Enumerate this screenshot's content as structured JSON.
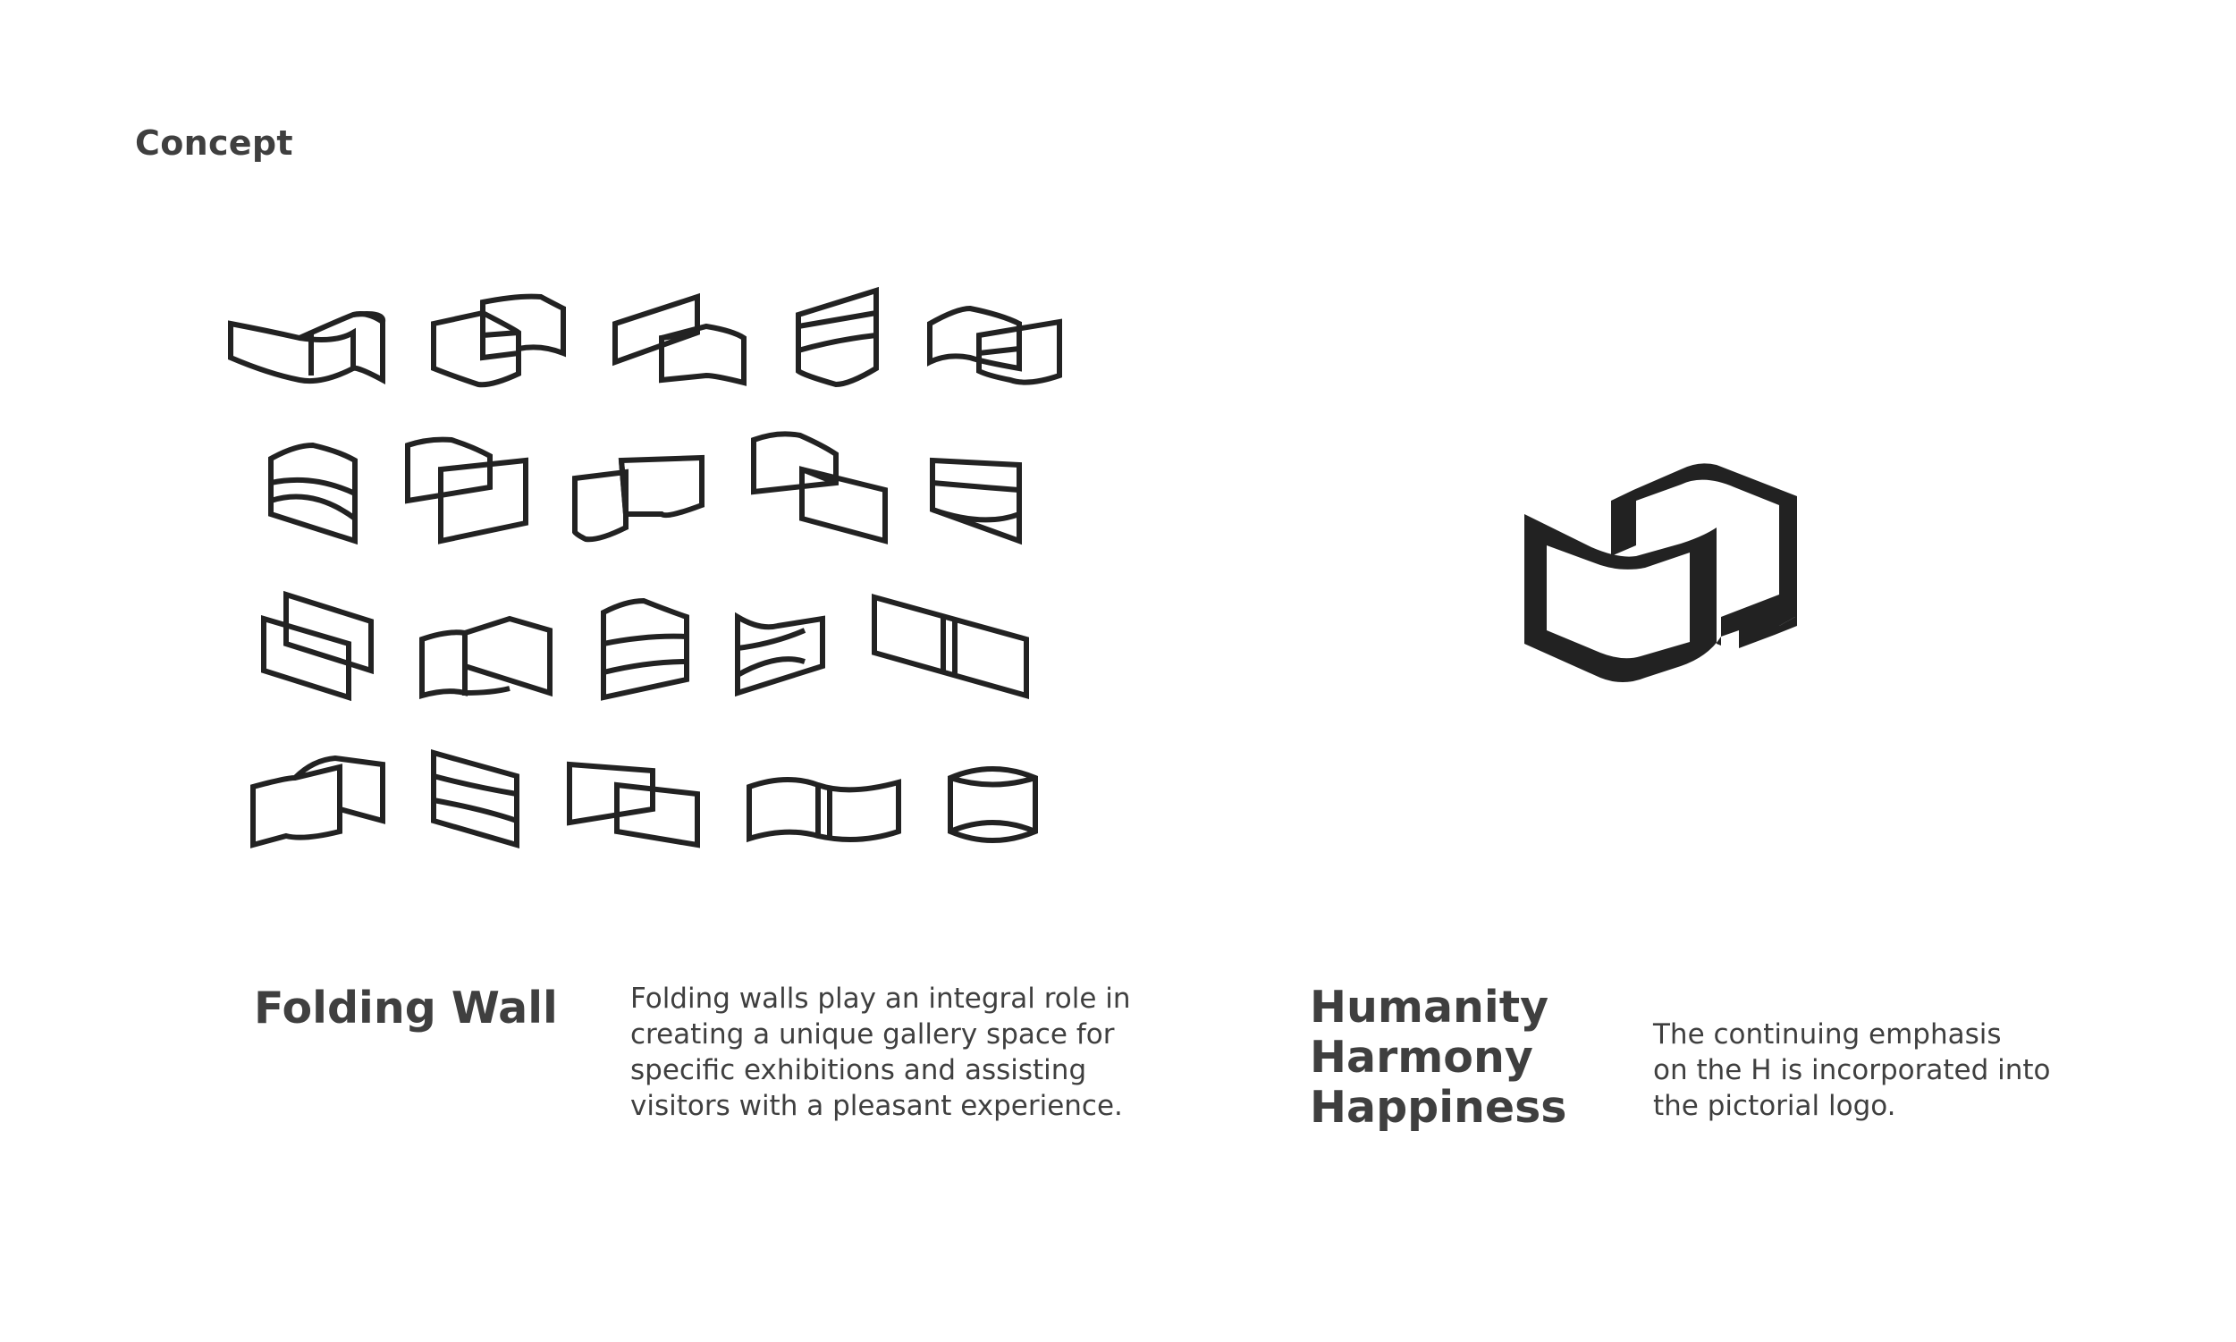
{
  "page": {
    "title": "Concept"
  },
  "folding_wall": {
    "heading": "Folding Wall",
    "description_lines": [
      "Folding walls play an integral role in",
      "creating a unique gallery space for",
      "specific exhibitions and assisting",
      "visitors with a pleasant experience."
    ],
    "sketch_icon_name": "folding-wall-sketch-icon"
  },
  "logo": {
    "heading_lines": [
      "Humanity",
      "Harmony",
      "Happiness"
    ],
    "description_lines": [
      "The continuing emphasis",
      "on the H is incorporated into",
      "the pictorial logo."
    ],
    "icon_name": "pictorial-h-logo-icon"
  },
  "colors": {
    "ink": "#222222",
    "text": "#3f3f3f",
    "background": "#ffffff"
  }
}
